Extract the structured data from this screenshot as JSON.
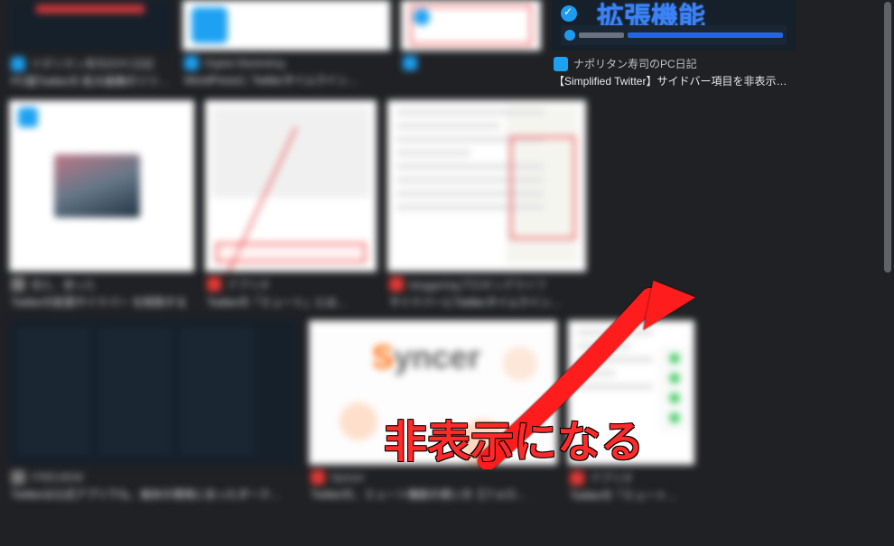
{
  "annotation": {
    "text": "非表示になる"
  },
  "row1": [
    {
      "source": "ナポリタン寿司のPC日記",
      "title": "PC版Twitterの 拡大画像のリツイート等履歴の…",
      "favClass": ""
    },
    {
      "source": "Digital Marketing",
      "title": "WordPressに Twitterタイムライン・サイドバー埋…",
      "favClass": ""
    },
    {
      "source": "",
      "title": "",
      "favClass": ""
    },
    {
      "source": "ナポリタン寿司のPC日記",
      "title": "【Simplified Twitter】サイドバー項目を非表示にす…",
      "favClass": "",
      "ext_label": "拡張機能"
    }
  ],
  "row2": [
    {
      "source": "見た、使った",
      "title": "Twitterの拡張サイドバー を削除する",
      "favClass": "gray"
    },
    {
      "source": "アプリオ",
      "title": "Twitterの「ミュート」とは…",
      "favClass": "red"
    },
    {
      "source": "bloggerlogブロギングライフ",
      "title": "サイドバーにTwitterタイムラインウィジ…",
      "favClass": "red"
    }
  ],
  "row3": [
    {
      "source": "ITREVIEW",
      "title": "Twitterは公式アプリでも、端末の環境に合ったダーク…",
      "favClass": "gray"
    },
    {
      "source": "Syncer",
      "title": "Twitterの、ミュート機能の使い方【フォロ…",
      "favClass": "red"
    },
    {
      "source": "アプリオ",
      "title": "Twitterの「ミュート」と…",
      "favClass": "red"
    }
  ]
}
